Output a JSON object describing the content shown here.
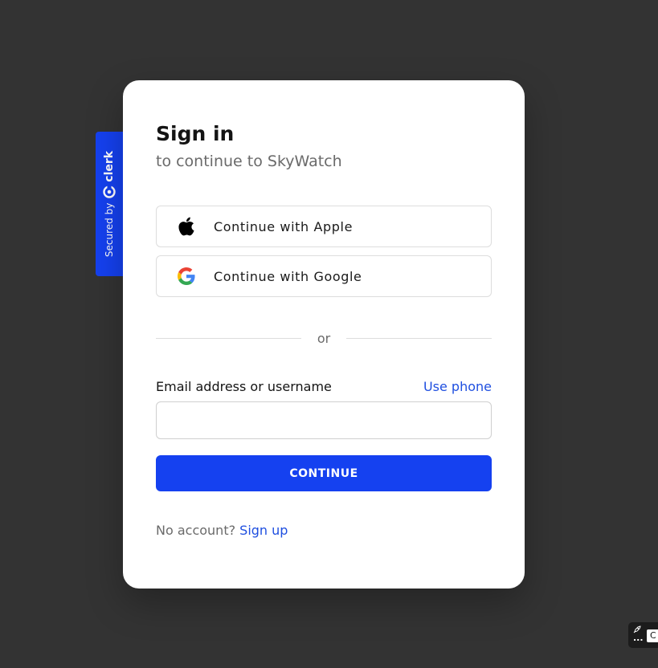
{
  "badge": {
    "secured_label": "Secured by",
    "brand_label": "clerk",
    "color": "#1541f0"
  },
  "card": {
    "title": "Sign in",
    "subtitle": "to continue to SkyWatch"
  },
  "social": {
    "apple": {
      "label": "Continue with Apple",
      "icon": "apple-icon"
    },
    "google": {
      "label": "Continue with Google",
      "icon": "google-icon"
    }
  },
  "divider": {
    "label": "or"
  },
  "form": {
    "email_label": "Email address or username",
    "use_phone_label": "Use phone",
    "email_value": "",
    "continue_label": "CONTINUE"
  },
  "footer": {
    "prompt": "No account?",
    "signup_label": "Sign up"
  },
  "devtools": {
    "menu_label": "...",
    "box_label": "C"
  },
  "colors": {
    "background": "#333333",
    "primary": "#1541f0",
    "link": "#1f4fe0"
  }
}
